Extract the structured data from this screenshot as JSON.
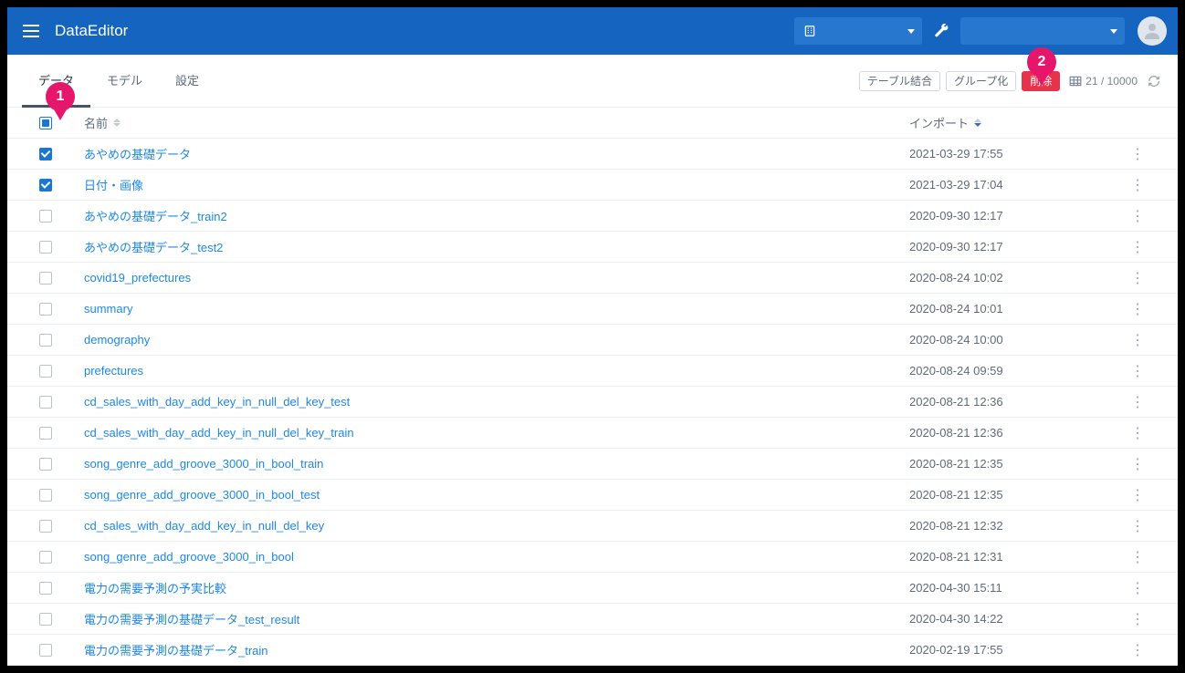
{
  "app": {
    "title": "DataEditor"
  },
  "badges": {
    "one": "1",
    "two": "2"
  },
  "tabs": {
    "data": "データ",
    "model": "モデル",
    "settings": "設定"
  },
  "toolbar": {
    "table_join": "テーブル結合",
    "group": "グループ化",
    "delete": "削除",
    "count_display": "21 / 10000"
  },
  "columns": {
    "name": "名前",
    "import": "インポート"
  },
  "header_state": {
    "select_all": "indeterminate",
    "sort_column": "import",
    "sort_dir": "desc"
  },
  "rows": [
    {
      "checked": true,
      "name": "あやめの基礎データ",
      "date": "2021-03-29 17:55"
    },
    {
      "checked": true,
      "name": "日付・画像",
      "date": "2021-03-29 17:04"
    },
    {
      "checked": false,
      "name": "あやめの基礎データ_train2",
      "date": "2020-09-30 12:17"
    },
    {
      "checked": false,
      "name": "あやめの基礎データ_test2",
      "date": "2020-09-30 12:17"
    },
    {
      "checked": false,
      "name": "covid19_prefectures",
      "date": "2020-08-24 10:02"
    },
    {
      "checked": false,
      "name": "summary",
      "date": "2020-08-24 10:01"
    },
    {
      "checked": false,
      "name": "demography",
      "date": "2020-08-24 10:00"
    },
    {
      "checked": false,
      "name": "prefectures",
      "date": "2020-08-24 09:59"
    },
    {
      "checked": false,
      "name": "cd_sales_with_day_add_key_in_null_del_key_test",
      "date": "2020-08-21 12:36"
    },
    {
      "checked": false,
      "name": "cd_sales_with_day_add_key_in_null_del_key_train",
      "date": "2020-08-21 12:36"
    },
    {
      "checked": false,
      "name": "song_genre_add_groove_3000_in_bool_train",
      "date": "2020-08-21 12:35"
    },
    {
      "checked": false,
      "name": "song_genre_add_groove_3000_in_bool_test",
      "date": "2020-08-21 12:35"
    },
    {
      "checked": false,
      "name": "cd_sales_with_day_add_key_in_null_del_key",
      "date": "2020-08-21 12:32"
    },
    {
      "checked": false,
      "name": "song_genre_add_groove_3000_in_bool",
      "date": "2020-08-21 12:31"
    },
    {
      "checked": false,
      "name": "電力の需要予測の予実比較",
      "date": "2020-04-30 15:11"
    },
    {
      "checked": false,
      "name": "電力の需要予測の基礎データ_test_result",
      "date": "2020-04-30 14:22"
    },
    {
      "checked": false,
      "name": "電力の需要予測の基礎データ_train",
      "date": "2020-02-19 17:55"
    }
  ]
}
